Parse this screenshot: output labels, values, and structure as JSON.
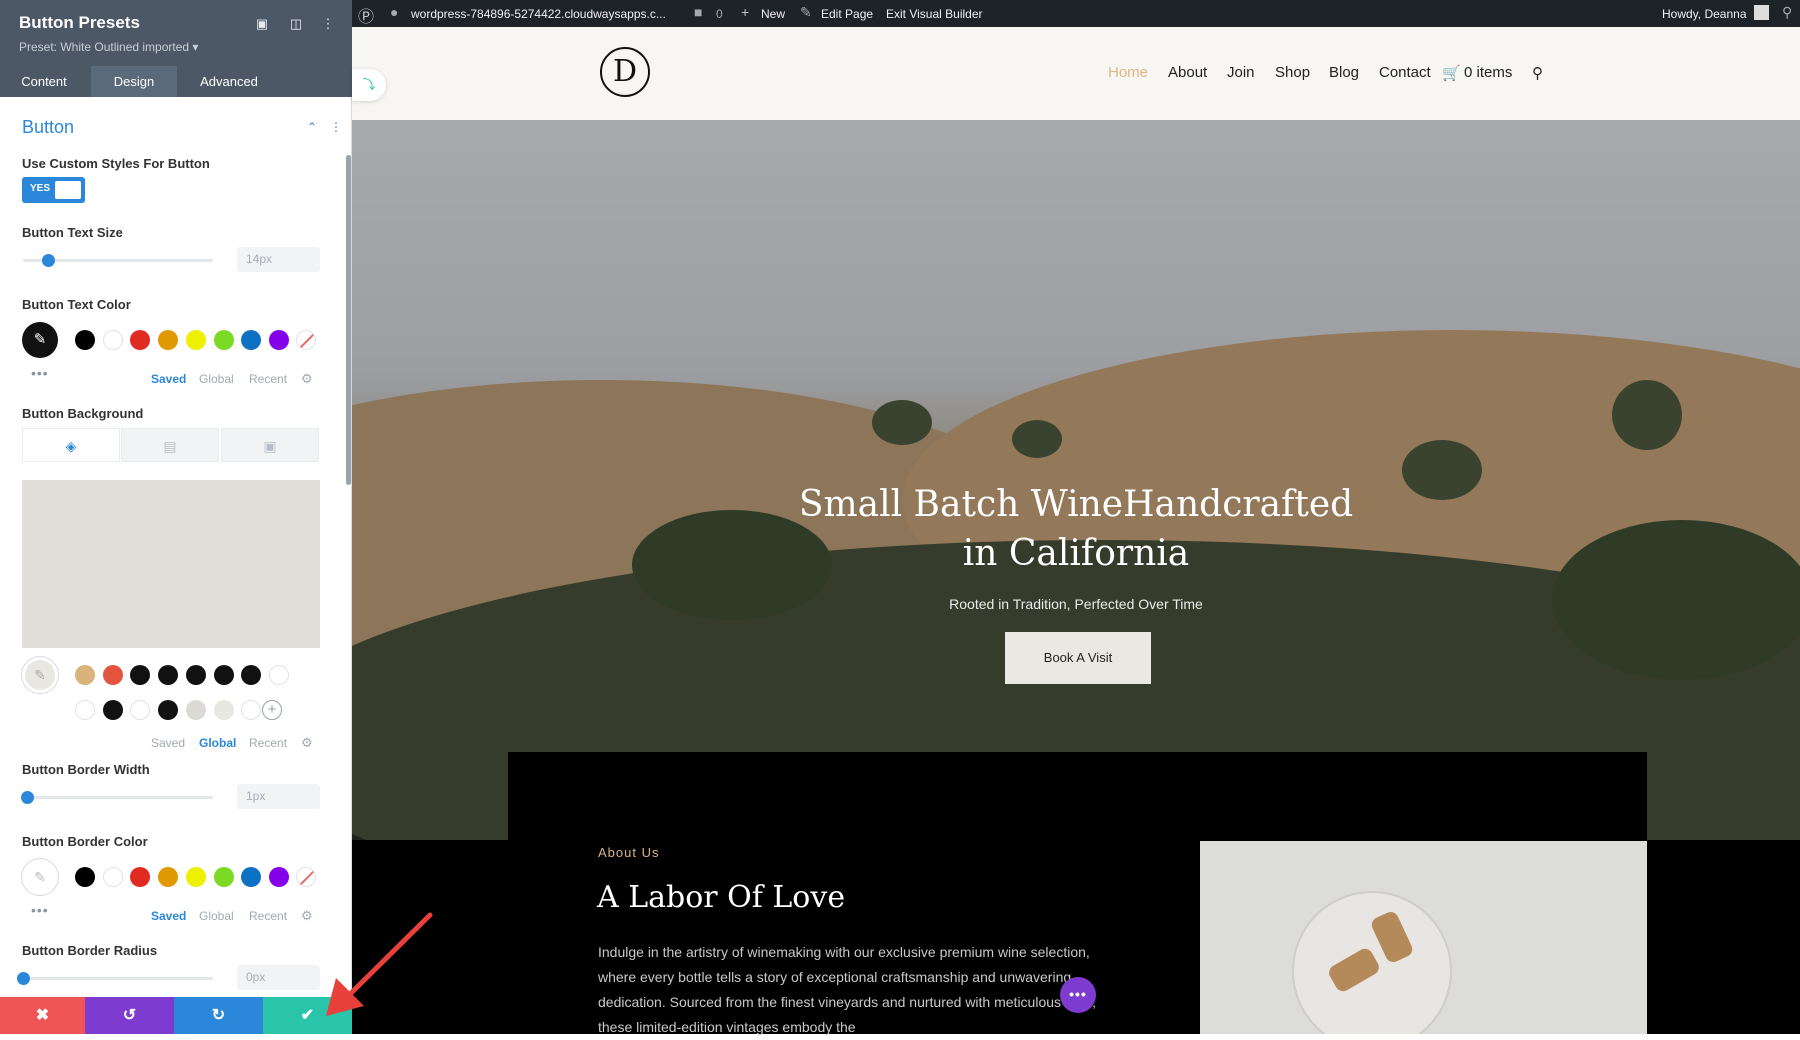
{
  "panel": {
    "title": "Button Presets",
    "subtitle": "Preset: White Outlined imported ▾",
    "tabs": [
      "Content",
      "Design",
      "Advanced"
    ],
    "active_tab": "Design",
    "group_title": "Button",
    "fields": {
      "custom_styles_label": "Use Custom Styles For Button",
      "custom_styles_value": "YES",
      "text_size_label": "Button Text Size",
      "text_size_value": "14px",
      "text_size_fraction": 0.13,
      "text_color_label": "Button Text Color",
      "background_label": "Button Background",
      "border_width_label": "Button Border Width",
      "border_width_value": "1px",
      "border_width_fraction": 0.02,
      "border_color_label": "Button Border Color",
      "border_radius_label": "Button Border Radius",
      "border_radius_value": "0px",
      "border_radius_fraction": 0.0
    },
    "color_tabs": [
      "Saved",
      "Global",
      "Recent"
    ],
    "swatch_colors": [
      "#000000",
      "#ffffff",
      "#e02b20",
      "#e09900",
      "#edf000",
      "#7cda24",
      "#0c71c3",
      "#8300e9"
    ],
    "global_colors_row1": [
      "#d9b27c",
      "#e2543e",
      "#111111",
      "#111111",
      "#111111",
      "#111111",
      "#111111",
      "#ffffff"
    ],
    "global_colors_row2": [
      "#ffffff",
      "#111111",
      "#ffffff",
      "#111111",
      "#dcdad4",
      "#e9e7e1",
      "#ffffff"
    ],
    "background_preview_color": "#e0dfda",
    "accent_color": "#2b87da"
  },
  "actions": {
    "cancel": "✖",
    "undo": "↺",
    "redo": "↻",
    "save": "✔"
  },
  "adminbar": {
    "site": "wordpress-784896-5274422.cloudwaysapps.c...",
    "comments": "0",
    "new": "New",
    "edit_page": "Edit Page",
    "exit_builder": "Exit Visual Builder",
    "greeting": "Howdy, Deanna"
  },
  "site": {
    "logo": "D",
    "nav": [
      "Home",
      "About",
      "Join",
      "Shop",
      "Blog",
      "Contact"
    ],
    "cart": "0 items",
    "accent": "#e0b686"
  },
  "hero": {
    "title_line1": "Small Batch WineHandcrafted",
    "title_line2": "in California",
    "subtitle": "Rooted in Tradition, Perfected Over Time",
    "button": "Book A Visit"
  },
  "about": {
    "kicker": "About Us",
    "title": "A Labor Of Love",
    "text": "Indulge in the artistry of winemaking with our exclusive premium wine selection, where every bottle tells a story of exceptional craftsmanship and unwavering dedication. Sourced from the finest vineyards and nurtured with meticulous care, these limited-edition vintages embody the"
  }
}
